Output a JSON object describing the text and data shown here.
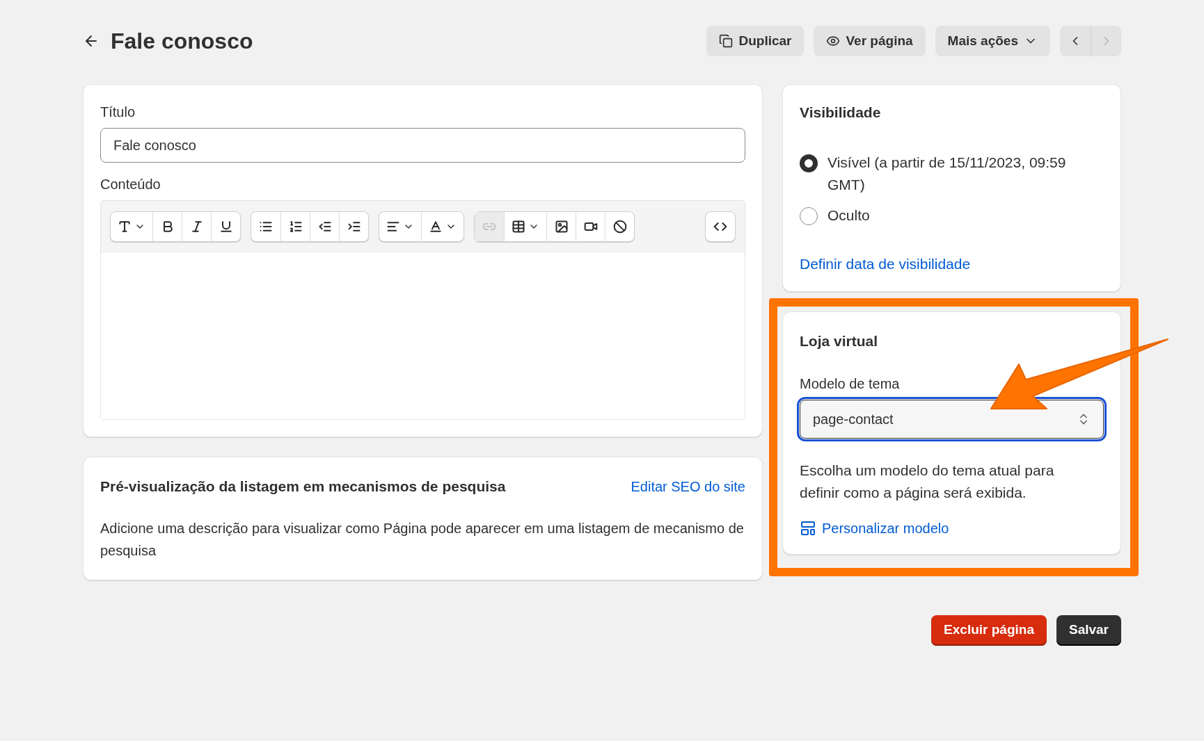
{
  "header": {
    "title": "Fale conosco",
    "actions": [
      {
        "kind": "duplicate",
        "label": "Duplicar"
      },
      {
        "kind": "view",
        "label": "Ver página"
      },
      {
        "kind": "more",
        "label": "Mais ações"
      }
    ],
    "pager": [
      {
        "kind": "previous",
        "disabled": false
      },
      {
        "kind": "next",
        "disabled": true
      }
    ]
  },
  "content_card": {
    "title_label": "Título",
    "title_value": "Fale conosco",
    "content_label": "Conteúdo",
    "toolbar": [
      [
        {
          "disabled": false,
          "dropdown": true
        },
        {
          "disabled": false,
          "dropdown": false
        },
        {
          "disabled": false,
          "dropdown": false
        },
        {
          "disabled": false,
          "dropdown": false
        }
      ],
      [
        {
          "disabled": false,
          "dropdown": false
        },
        {
          "disabled": false,
          "dropdown": false
        },
        {
          "disabled": false,
          "dropdown": false
        },
        {
          "disabled": false,
          "dropdown": false
        }
      ],
      [
        {
          "disabled": false,
          "dropdown": true
        },
        {
          "disabled": false,
          "dropdown": true
        }
      ],
      [
        {
          "disabled": true,
          "dropdown": false
        },
        {
          "disabled": false,
          "dropdown": true
        },
        {
          "disabled": false,
          "dropdown": false
        },
        {
          "disabled": false,
          "dropdown": false
        },
        {
          "disabled": false,
          "dropdown": false
        }
      ],
      [
        {
          "disabled": false,
          "dropdown": false
        }
      ]
    ]
  },
  "seo_card": {
    "title": "Pré-visualização da listagem em mecanismos de pesquisa",
    "link": "Editar SEO do site",
    "description": "Adicione uma descrição para visualizar como Página pode aparecer em uma listagem de mecanismo de pesquisa"
  },
  "visibility_card": {
    "title": "Visibilidade",
    "options": [
      {
        "label": "Visível (a partir de 15/11/2023, 09:59 GMT)",
        "selected": true
      },
      {
        "label": "Oculto",
        "selected": false
      }
    ],
    "link": "Definir data de visibilidade"
  },
  "store_card": {
    "title": "Loja virtual",
    "field_label": "Modelo de tema",
    "field_value": "page-contact",
    "focused": true,
    "help": "Escolha um modelo do tema atual para definir como a página será exibida.",
    "link": "Personalizar modelo",
    "highlighted": true
  },
  "footer": {
    "buttons": [
      {
        "kind": "danger",
        "label": "Excluir página"
      },
      {
        "kind": "primary",
        "label": "Salvar"
      }
    ]
  }
}
